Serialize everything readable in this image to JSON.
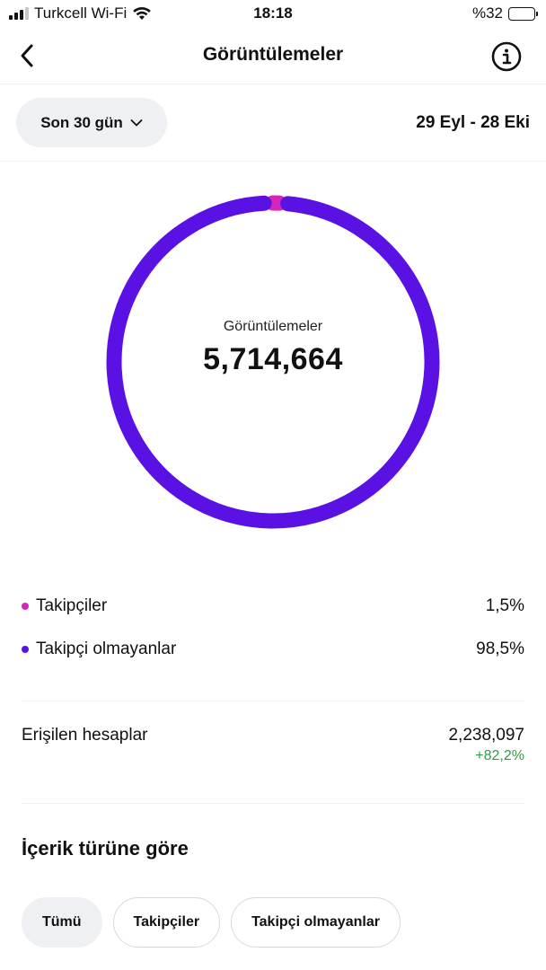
{
  "status_bar": {
    "carrier": "Turkcell Wi-Fi",
    "time": "18:18",
    "battery": "%32",
    "battery_level": 0.32
  },
  "header": {
    "title": "Görüntülemeler",
    "back_icon": "chevron-left-icon",
    "info_icon": "info-icon"
  },
  "filter": {
    "range_label": "Son 30 gün",
    "dates": "29 Eyl - 28 Eki"
  },
  "donut": {
    "label": "Görüntülemeler",
    "value": "5,714,664",
    "segments": [
      {
        "name": "Takipçiler",
        "fraction": 0.015,
        "color": "#d526b9"
      },
      {
        "name": "Takipçi olmayanlar",
        "fraction": 0.985,
        "color": "#5a11e4"
      }
    ]
  },
  "legend": [
    {
      "label": "Takipçiler",
      "value": "1,5%",
      "color": "#d526b9"
    },
    {
      "label": "Takipçi olmayanlar",
      "value": "98,5%",
      "color": "#5a11e4"
    }
  ],
  "reach": {
    "label": "Erişilen hesaplar",
    "value": "2,238,097",
    "change": "+82,2%",
    "change_color": "#2e9b47"
  },
  "section": {
    "title": "İçerik türüne göre"
  },
  "chips": [
    {
      "label": "Tümü",
      "active": true
    },
    {
      "label": "Takipçiler",
      "active": false
    },
    {
      "label": "Takipçi olmayanlar",
      "active": false
    }
  ]
}
